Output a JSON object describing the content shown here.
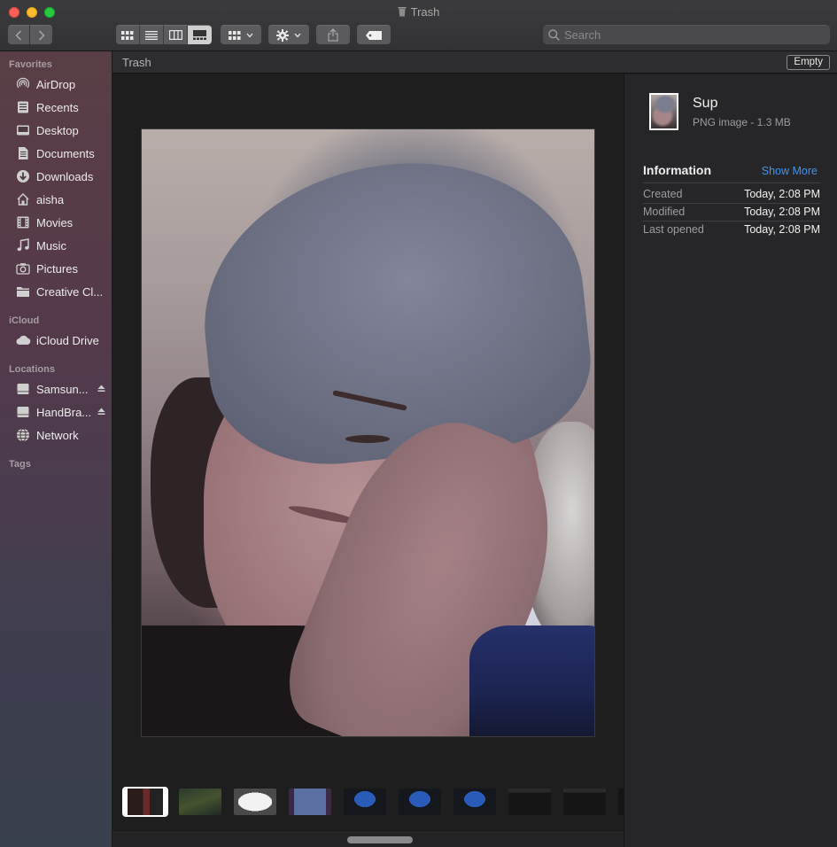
{
  "window": {
    "title": "Trash"
  },
  "toolbar": {
    "search_placeholder": "Search"
  },
  "sidebar": {
    "sections": [
      {
        "title": "Favorites",
        "items": [
          {
            "label": "AirDrop",
            "icon": "airdrop-icon"
          },
          {
            "label": "Recents",
            "icon": "recents-icon"
          },
          {
            "label": "Desktop",
            "icon": "desktop-icon"
          },
          {
            "label": "Documents",
            "icon": "documents-icon"
          },
          {
            "label": "Downloads",
            "icon": "downloads-icon"
          },
          {
            "label": "aisha",
            "icon": "home-icon"
          },
          {
            "label": "Movies",
            "icon": "movies-icon"
          },
          {
            "label": "Music",
            "icon": "music-icon"
          },
          {
            "label": "Pictures",
            "icon": "pictures-icon"
          },
          {
            "label": "Creative Cl...",
            "icon": "folder-icon"
          }
        ]
      },
      {
        "title": "iCloud",
        "items": [
          {
            "label": "iCloud Drive",
            "icon": "cloud-icon"
          }
        ]
      },
      {
        "title": "Locations",
        "items": [
          {
            "label": "Samsun...",
            "icon": "drive-icon"
          },
          {
            "label": "HandBra...",
            "icon": "drive-icon"
          },
          {
            "label": "Network",
            "icon": "network-icon"
          }
        ]
      },
      {
        "title": "Tags",
        "items": []
      }
    ]
  },
  "pathbar": {
    "title": "Trash",
    "empty_label": "Empty"
  },
  "inspector": {
    "name": "Sup",
    "kind": "PNG image - 1.3 MB",
    "section_title": "Information",
    "show_more": "Show More",
    "rows": [
      {
        "key": "Created",
        "value": "Today, 2:08 PM"
      },
      {
        "key": "Modified",
        "value": "Today, 2:08 PM"
      },
      {
        "key": "Last opened",
        "value": "Today, 2:08 PM"
      }
    ]
  },
  "colors": {
    "accent": "#3d95f5",
    "sidebar_top": "#5a3e46",
    "sidebar_bottom": "#39404e",
    "window_bg": "#1e1e1e"
  }
}
